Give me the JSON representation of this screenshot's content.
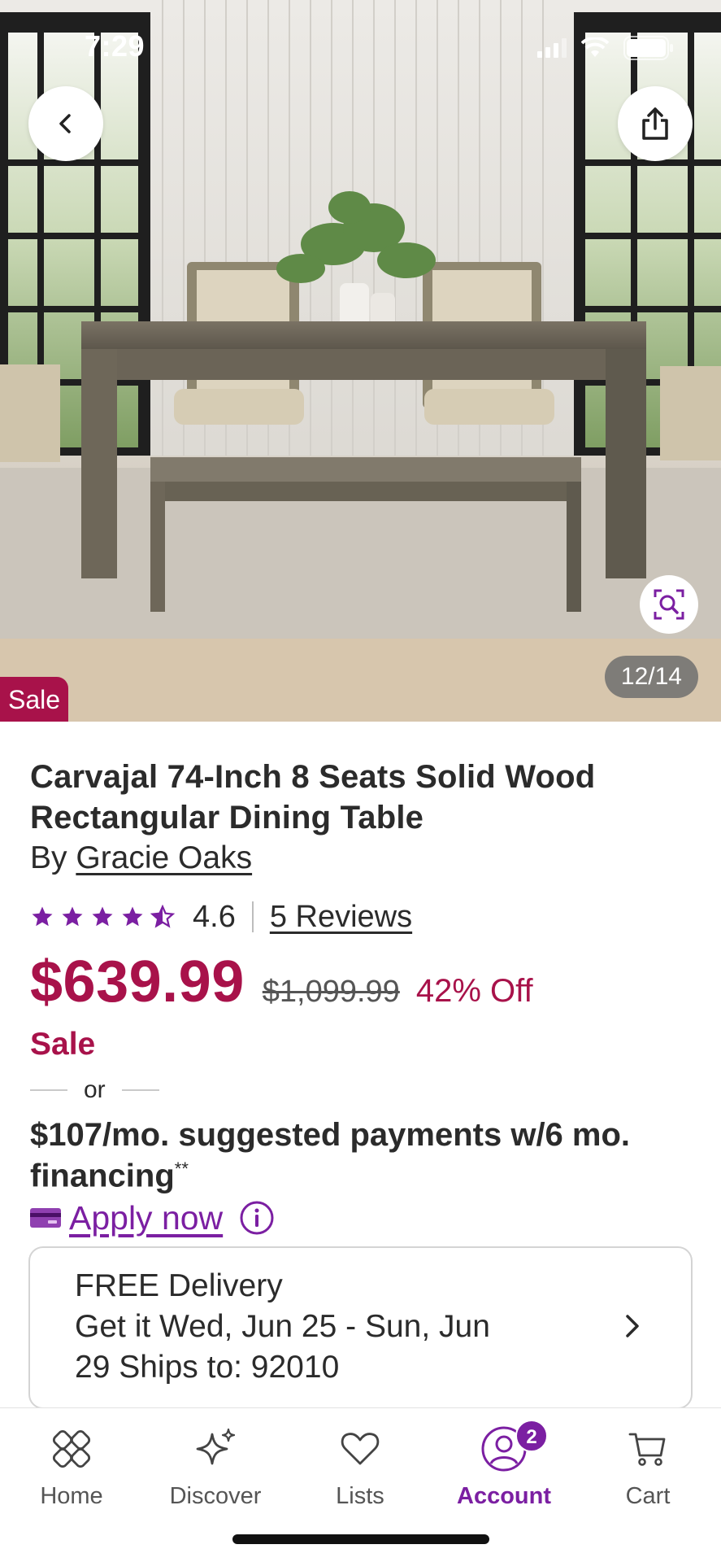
{
  "status_bar": {
    "time": "7:29"
  },
  "gallery": {
    "counter": "12/14",
    "sale_tag": "Sale"
  },
  "product": {
    "title": "Carvajal 74-Inch 8 Seats Solid Wood Rectangular Dining Table",
    "by_prefix": "By ",
    "brand": "Gracie Oaks",
    "rating": "4.6",
    "rating_fraction": 0.92,
    "reviews_link": "5 Reviews",
    "price": "$639.99",
    "original_price": "$1,099.99",
    "discount": "42% Off",
    "sale_label": "Sale",
    "or_text": "or",
    "financing_text": "$107/mo. suggested payments w/6 mo. financing",
    "financing_mark": "**",
    "apply_link": "Apply now"
  },
  "delivery": {
    "line1": "FREE Delivery",
    "line2": "Get it Wed, Jun 25 - Sun, Jun",
    "line3": "29 Ships to: 92010"
  },
  "nav": {
    "items": [
      {
        "label": "Home",
        "icon": "home-icon"
      },
      {
        "label": "Discover",
        "icon": "sparkle-icon"
      },
      {
        "label": "Lists",
        "icon": "heart-icon"
      },
      {
        "label": "Account",
        "icon": "account-icon",
        "badge": "2",
        "active": true
      },
      {
        "label": "Cart",
        "icon": "cart-icon"
      }
    ]
  },
  "colors": {
    "brand_purple": "#7b1fa2",
    "sale_red": "#a8124a",
    "text": "#2b2b2b"
  }
}
